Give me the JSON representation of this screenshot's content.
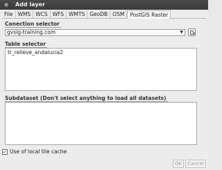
{
  "window": {
    "title": "Add layer"
  },
  "tabs": [
    {
      "label": "File"
    },
    {
      "label": "WMS"
    },
    {
      "label": "WCS"
    },
    {
      "label": "WFS"
    },
    {
      "label": "WMTS"
    },
    {
      "label": "GeoDB"
    },
    {
      "label": "OSM"
    },
    {
      "label": "PostGIS Raster",
      "active": true
    }
  ],
  "connection": {
    "label": "Conection selector",
    "selected": "gvsig-training.com"
  },
  "table_selector": {
    "label": "Table selector",
    "items": [
      "tr_relieve_andalucia2"
    ]
  },
  "subdataset": {
    "label": "Subdataset (Don't select anything to load all datasets)",
    "items": []
  },
  "tile_cache": {
    "label": "Use of local tile cache",
    "checked": true
  },
  "footer": {
    "ok_label": "OK",
    "cancel_label": "Cancel"
  }
}
